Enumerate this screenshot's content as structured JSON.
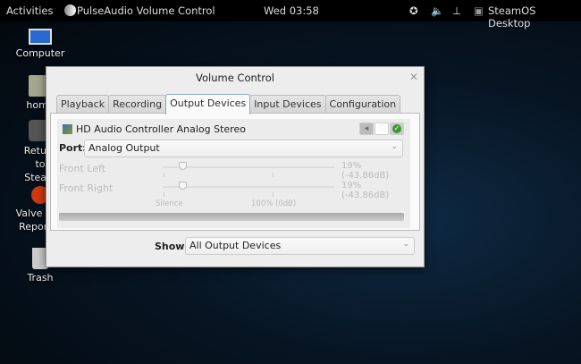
{
  "topbar": {
    "activities": "Activities",
    "app": "PulseAudio Volume Control",
    "clock": "Wed 03:58",
    "user": "SteamOS Desktop"
  },
  "desktop": [
    {
      "label": "Computer"
    },
    {
      "label": "home"
    },
    {
      "label": "Return to Steam"
    },
    {
      "label": "Valve Bug Reporter"
    },
    {
      "label": "Trash"
    }
  ],
  "window": {
    "title": "Volume Control",
    "tabs": [
      "Playback",
      "Recording",
      "Output Devices",
      "Input Devices",
      "Configuration"
    ],
    "active_tab": "Output Devices",
    "device": {
      "name": "HD Audio Controller Analog Stereo",
      "port_label": "Port:",
      "port": "Analog Output",
      "channels": [
        {
          "name": "Front Left",
          "value": "19% (-43.86dB)",
          "percent": 19
        },
        {
          "name": "Front Right",
          "value": "19% (-43.86dB)",
          "percent": 19
        }
      ],
      "scale_silence": "Silence",
      "scale_100": "100% (0dB)"
    },
    "show_label": "Show:",
    "show_value": "All Output Devices"
  }
}
